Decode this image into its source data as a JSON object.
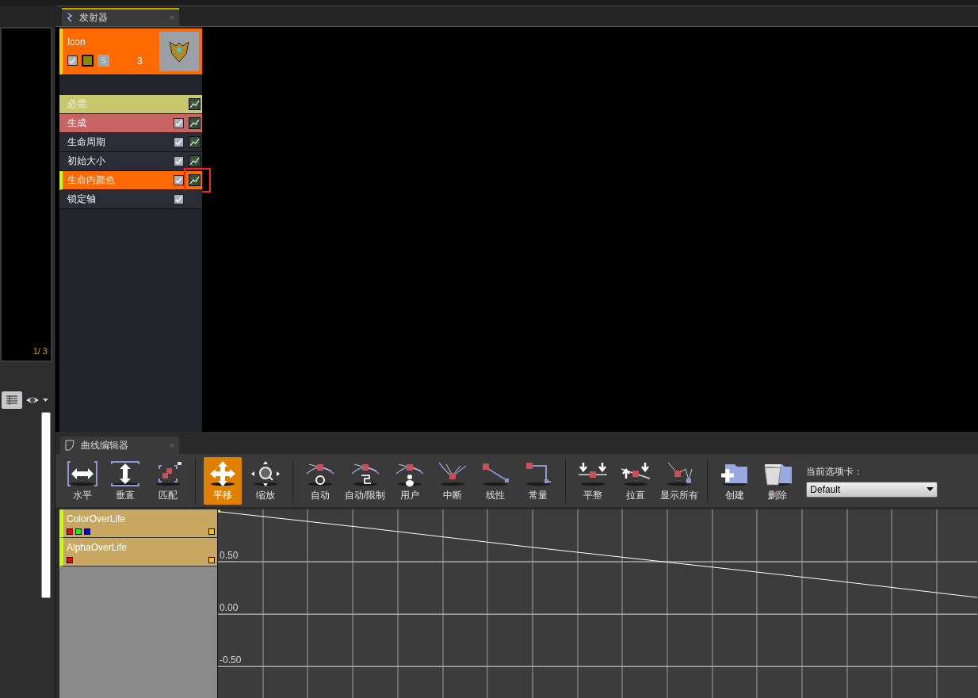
{
  "viewport": {
    "counter": "1/ 3"
  },
  "emitter_tab": {
    "title": "发射器",
    "close": "×"
  },
  "emitter": {
    "name": "Icon",
    "enabled": true,
    "solo_label": "S",
    "count": "3"
  },
  "modules": [
    {
      "label": "必需",
      "color": "#c8c86c",
      "selected": false,
      "curve_button": true,
      "highlighted": false
    },
    {
      "label": "生成",
      "color": "#c86464",
      "selected": false,
      "checked": true,
      "curve_button": true,
      "highlighted": false
    },
    {
      "label": "生命周期",
      "color": "#2c2c36",
      "selected": false,
      "checked": true,
      "curve_button": true,
      "highlighted": false
    },
    {
      "label": "初始大小",
      "color": "#2c2c36",
      "selected": false,
      "checked": true,
      "curve_button": true,
      "highlighted": false
    },
    {
      "label": "生命内颜色",
      "color": "#ff6a00",
      "selected": true,
      "checked": true,
      "curve_button": true,
      "highlighted": true
    },
    {
      "label": "锁定轴",
      "color": "#2c2c36",
      "selected": false,
      "checked": true,
      "curve_button": false,
      "highlighted": false
    }
  ],
  "curve_tab": {
    "title": "曲线编辑器",
    "close": "×"
  },
  "toolbar": {
    "groups": [
      [
        {
          "label": "水平",
          "kind": "fit-h",
          "selected": false
        },
        {
          "label": "垂直",
          "kind": "fit-v",
          "selected": false
        },
        {
          "label": "匹配",
          "kind": "fit",
          "selected": false
        }
      ],
      [
        {
          "label": "平移",
          "kind": "pan",
          "selected": true
        },
        {
          "label": "缩放",
          "kind": "zoom",
          "selected": false
        }
      ],
      [
        {
          "label": "自动",
          "kind": "auto",
          "selected": false
        },
        {
          "label": "自动/限制",
          "kind": "clamp",
          "selected": false
        },
        {
          "label": "用户",
          "kind": "user",
          "selected": false
        },
        {
          "label": "中断",
          "kind": "break",
          "selected": false
        },
        {
          "label": "线性",
          "kind": "linear",
          "selected": false
        },
        {
          "label": "常量",
          "kind": "constant",
          "selected": false
        }
      ],
      [
        {
          "label": "平整",
          "kind": "flatten",
          "selected": false
        },
        {
          "label": "拉直",
          "kind": "straighten",
          "selected": false
        },
        {
          "label": "显示所有",
          "kind": "showall",
          "selected": false
        }
      ],
      [
        {
          "label": "创建",
          "kind": "create",
          "selected": false
        },
        {
          "label": "删除",
          "kind": "delete",
          "selected": false
        }
      ]
    ],
    "tab_select": {
      "label": "当前选项卡：",
      "value": "Default"
    }
  },
  "tracks": [
    {
      "name": "ColorOverLife",
      "channels": [
        {
          "color": "#ff0000"
        },
        {
          "color": "#00ff00"
        },
        {
          "color": "#0000ff"
        }
      ]
    },
    {
      "name": "AlphaOverLife",
      "channels": [
        {
          "color": "#ff0000"
        }
      ]
    }
  ],
  "chart_data": {
    "type": "line",
    "grid": true,
    "ylim": [
      -0.8,
      1.0
    ],
    "yticks": [
      {
        "value": 0.5,
        "label": "0.50"
      },
      {
        "value": 0,
        "label": "0.00"
      },
      {
        "value": -0.5,
        "label": "-0.50"
      }
    ],
    "series": [
      {
        "color": "#ffffff",
        "values": [
          0.98,
          0.82,
          0.65,
          0.49,
          0.33,
          0.16
        ]
      }
    ]
  }
}
